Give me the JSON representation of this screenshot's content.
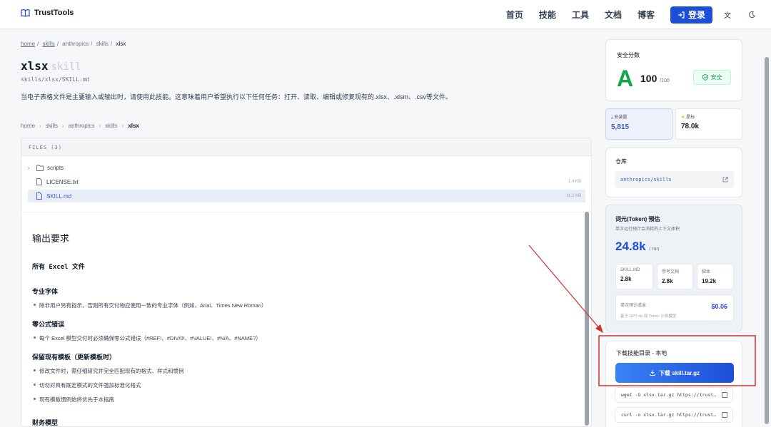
{
  "header": {
    "brand": "TrustTools",
    "nav": [
      "首页",
      "技能",
      "工具",
      "文档",
      "博客"
    ],
    "login": "登录"
  },
  "breadcrumb_top": [
    "home",
    "skills",
    "anthropics",
    "skills",
    "xlsx"
  ],
  "page": {
    "title": "xlsx",
    "title_suffix": "skill",
    "path": "skills/xlsx/SKILL.md",
    "description": "当电子表格文件是主要输入或输出时，请使用此技能。这意味着用户希望执行以下任何任务：打开、读取、编辑或修复现有的.xlsx、.xlsm、.csv等文件。"
  },
  "breadcrumb_bottom": [
    "home",
    "skills",
    "anthropics",
    "skills",
    "xlsx"
  ],
  "files": {
    "header": "FILES (3)",
    "items": [
      {
        "name": "scripts",
        "type": "folder",
        "size": ""
      },
      {
        "name": "LICENSE.txt",
        "type": "file",
        "size": "1.4 KB"
      },
      {
        "name": "SKILL.md",
        "type": "file",
        "size": "11.2 KB",
        "selected": true
      }
    ]
  },
  "doc": {
    "h1": "输出要求",
    "s1": "所有 Excel 文件",
    "s2": "专业字体",
    "s2_items": [
      "除非用户另有指示，否则所有交付物应使用一致的专业字体（例如，Arial、Times New Roman）"
    ],
    "s3": "零公式错误",
    "s3_items": [
      "每个 Excel 模型交付时必须确保零公式错误（#REF!、#DIV/0!、#VALUE!、#N/A、#NAME?）"
    ],
    "s4": "保留现有模板（更新模板时）",
    "s4_items": [
      "修改文件时，需仔细研究并完全匹配现有的格式、样式和惯例",
      "切勿对具有既定模式的文件强加标准化格式",
      "现有模板惯例始终优先于本指南"
    ],
    "s5": "财务模型"
  },
  "security": {
    "label": "安全分数",
    "grade": "A",
    "score": "100",
    "max": "/100",
    "badge": "安全"
  },
  "stats": {
    "installs_label": "安装量",
    "installs": "5,815",
    "stars_label": "星标",
    "stars": "78.0k"
  },
  "repo": {
    "label": "仓库",
    "name": "anthropics/skills"
  },
  "token": {
    "title": "词元(Token) 预估",
    "subtitle": "单次运行预计会消耗的上下文体积",
    "value": "24.8k",
    "unit": "/ run",
    "boxes": [
      {
        "k": "SKILL.MD",
        "v": "2.8k"
      },
      {
        "k": "参考文档",
        "v": "2.8k"
      },
      {
        "k": "脚本",
        "v": "19.2k"
      }
    ],
    "cost_label": "单次预计成本",
    "cost_note": "基于 GPT-4o 和 Token 计费模型",
    "cost": "$0.06"
  },
  "download": {
    "title": "下载技能目录 - 本地",
    "button": "下载 skill.tar.gz",
    "wget": "wget -O xlsx.tar.gz https://trust…",
    "curl": "curl -o xlsx.tar.gz https://trust…"
  },
  "colors": {
    "primary": "#1d4ed8",
    "safe": "#16a34a",
    "annotation": "#d32f2f"
  }
}
